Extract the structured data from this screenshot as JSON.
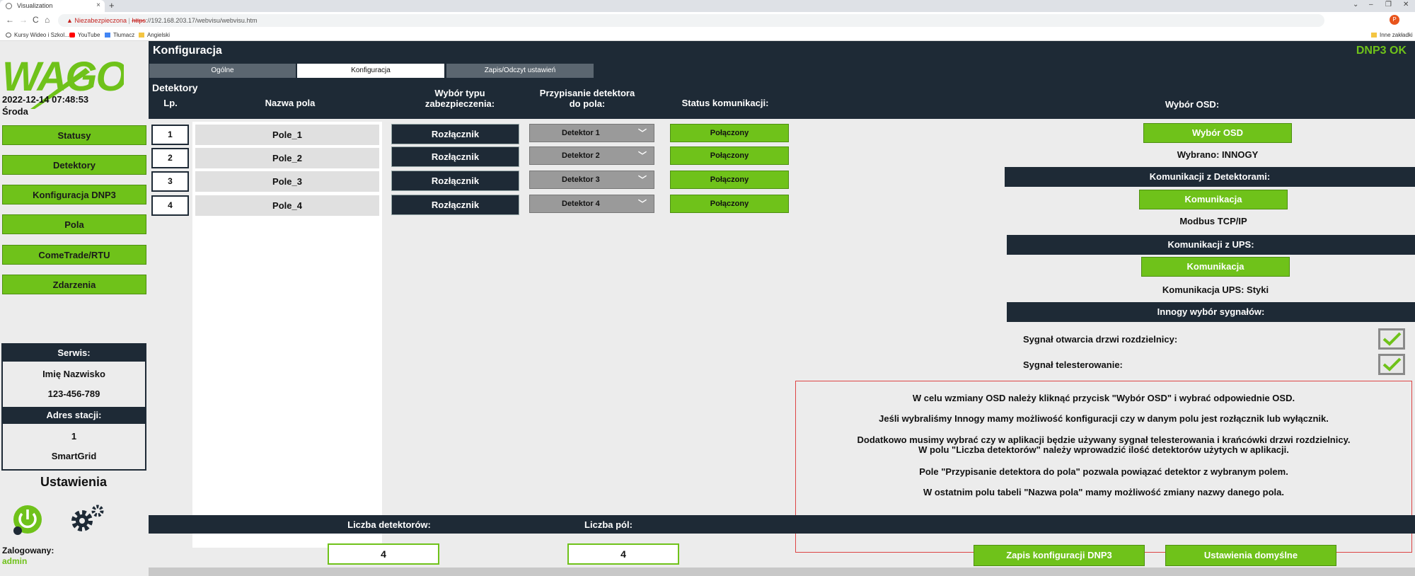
{
  "browser": {
    "tab_title": "Visualization",
    "tab_close": "×",
    "new_tab": "+",
    "window_controls": [
      "⌄",
      "–",
      "❐",
      "✕"
    ],
    "nav": [
      "←",
      "→",
      "C",
      "⌂"
    ],
    "security_warning": "Niezabezpieczona",
    "url_protocol": "https",
    "url_rest": "://192.168.203.17/webvisu/webvisu.htm",
    "bookmarks": [
      "Kursy Wideo i Szkol...",
      "YouTube",
      "Tłumacz",
      "Angielski"
    ],
    "other_bookmarks": "Inne zakładki"
  },
  "sidebar": {
    "datetime": "2022-12-14 07:48:53",
    "weekday": "Środa",
    "nav": [
      "Statusy",
      "Detektory",
      "Konfiguracja DNP3",
      "Pola",
      "ComeTrade/RTU",
      "Zdarzenia"
    ],
    "service": {
      "header": "Serwis:",
      "name": "Imię Nazwisko",
      "phone": "123-456-789",
      "station_header": "Adres stacji:",
      "station_no": "1",
      "station_name": "SmartGrid"
    },
    "settings_title": "Ustawienia",
    "logged_label": "Zalogowany:",
    "user": "admin"
  },
  "header": {
    "title": "Konfiguracja",
    "status": "DNP3 OK",
    "tabs": [
      "Ogólne",
      "Konfiguracja",
      "Zapis/Odczyt ustawień"
    ]
  },
  "detectors": {
    "section_title": "Detektory",
    "col_lp": "Lp.",
    "col_name": "Nazwa pola",
    "col_type": "Wybór typu zabezpieczenia:",
    "col_assign": "Przypisanie detektora do pola:",
    "col_status": "Status komunikacji:",
    "rows": [
      {
        "lp": "1",
        "name": "Pole_1",
        "type": "Rozłącznik",
        "detector": "Detektor 1",
        "status": "Połączony"
      },
      {
        "lp": "2",
        "name": "Pole_2",
        "type": "Rozłącznik",
        "detector": "Detektor 2",
        "status": "Połączony"
      },
      {
        "lp": "3",
        "name": "Pole_3",
        "type": "Rozłącznik",
        "detector": "Detektor 3",
        "status": "Połączony"
      },
      {
        "lp": "4",
        "name": "Pole_4",
        "type": "Rozłącznik",
        "detector": "Detektor 4",
        "status": "Połączony"
      }
    ]
  },
  "osd": {
    "title": "Wybór OSD:",
    "button": "Wybór OSD",
    "selected": "Wybrano: INNOGY",
    "det_comm_header": "Komunikacji z Detektorami:",
    "det_comm_button": "Komunikacja",
    "det_comm_value": "Modbus TCP/IP",
    "ups_header": "Komunikacji z UPS:",
    "ups_button": "Komunikacja",
    "ups_value": "Komunikacja UPS: Styki",
    "signals_header": "Innogy wybór sygnałów:",
    "signal_1": "Sygnał otwarcia drzwi rozdzielnicy:",
    "signal_2": "Sygnał telesterowanie:"
  },
  "info": [
    "W celu wzmiany OSD należy kliknąć przycisk \"Wybór OSD\" i wybrać odpowiednie OSD.",
    "Jeśli wybraliśmy Innogy mamy możliwość konfiguracji czy w danym polu jest rozłącznik lub wyłącznik.",
    "Dodatkowo musimy wybrać czy w aplikacji będzie używany sygnał telesterowania i krańcówki drzwi rozdzielnicy.",
    "W polu \"Liczba detektorów\" należy wprowadzić ilość detektorów użytych w aplikacji.",
    "Pole \"Przypisanie detektora do pola\" pozwala powiązać detektor z wybranym polem.",
    "W ostatnim polu tabeli \"Nazwa pola\" mamy możliwość zmiany nazwy danego pola."
  ],
  "bottom": {
    "det_count_label": "Liczba detektorów:",
    "det_count": "4",
    "field_count_label": "Liczba pól:",
    "field_count": "4",
    "save_button": "Zapis konfiguracji DNP3",
    "defaults_button": "Ustawienia domyślne"
  },
  "colors": {
    "accent": "#6fc21a",
    "dark": "#1e2a36",
    "warning": "#c5221f"
  }
}
